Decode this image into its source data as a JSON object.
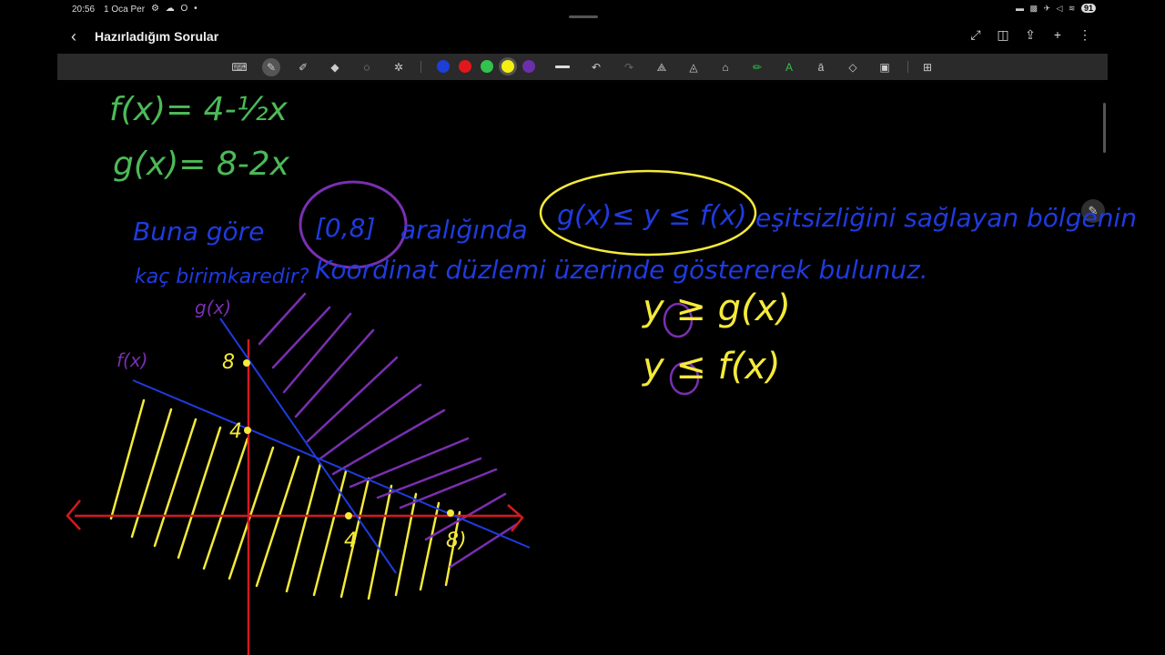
{
  "status_bar": {
    "time": "20:56",
    "date": "1 Oca Per",
    "left_icons": "⚙ ☁ O •",
    "right_icons": "▬ ▩ ✈ ◁ ≋",
    "battery": "91"
  },
  "header": {
    "back_icon": "chevron-left-icon",
    "title": "Hazırladığım Sorular"
  },
  "header_actions": [
    "fullscreen-icon",
    "page-layout-icon",
    "export-icon",
    "add-icon",
    "more-icon"
  ],
  "toolbar": {
    "tools": [
      "keyboard-icon",
      "pen-icon",
      "highlighter-icon",
      "eraser-icon",
      "lasso-icon",
      "magic-icon"
    ],
    "colors": [
      "#1e3ed9",
      "#e3161b",
      "#33c24d",
      "#f5ef10",
      "#6b2fa8"
    ],
    "selected_color": "#f5ef10",
    "edit_tools": [
      "line-width-icon",
      "undo-icon",
      "redo-icon",
      "shape-pen-icon",
      "fill-icon",
      "stamp-icon",
      "marker-icon",
      "text-icon",
      "text-box-icon",
      "shapes-icon",
      "image-icon",
      "grid-icon"
    ]
  },
  "note": {
    "f_def": "f(x)= 4-½x",
    "g_def": "g(x)= 8-2x",
    "q_line1_a": "Buna göre",
    "q_interval": "[0,8]",
    "q_line1_b": "aralığında",
    "q_ineq": "g(x)≤ y ≤ f(x)",
    "q_line1_c": "eşitsizliğini sağlayan bölgenin",
    "q_line2_a": "kaç birimkaredir?",
    "q_line2_b": "Koordinat düzlemi üzerinde göstererek bulunuz.",
    "side1": "y ≥ g(x)",
    "side2": "y ≤ f(x)",
    "graph_labels": {
      "g": "g(x)",
      "f": "f(x)",
      "y8": "8",
      "y4": "4",
      "x4": "4",
      "x8": "8)"
    }
  }
}
